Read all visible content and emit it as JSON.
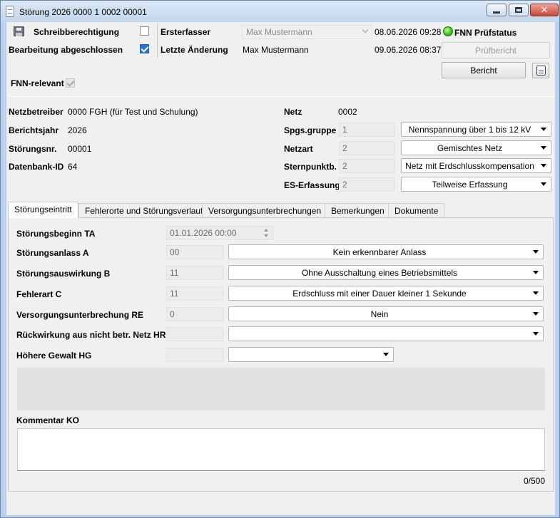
{
  "window": {
    "title": "Störung 2026 0000 1 0002 00001",
    "close_glyph": "✕"
  },
  "header": {
    "write_permission_label": "Schreibberechtigung",
    "write_permission_checked": false,
    "edit_completed_label": "Bearbeitung abgeschlossen",
    "edit_completed_checked": true,
    "fnn_relevant_label": "FNN-relevant",
    "fnn_relevant_checked": true,
    "creator_label": "Ersterfasser",
    "creator_value": "Max Mustermann",
    "created_date": "08.06.2026 09:28",
    "last_change_label": "Letzte Änderung",
    "last_change_value": "Max Mustermann",
    "last_change_date": "09.06.2026 08:37",
    "fnn_status_label": "FNN Prüfstatus",
    "fnn_status_color": "#39c41a",
    "check_report_button": "Prüfbericht",
    "report_button": "Bericht",
    "print_icon": "print-icon"
  },
  "info": {
    "operator_label": "Netzbetreiber",
    "operator_value": "0000 FGH (für Test und Schulung)",
    "report_year_label": "Berichtsjahr",
    "report_year_value": "2026",
    "fault_no_label": "Störungsnr.",
    "fault_no_value": "00001",
    "db_id_label": "Datenbank-ID",
    "db_id_value": "64",
    "grid_label": "Netz",
    "grid_value": "0002",
    "voltage_group_label": "Spgs.gruppe",
    "voltage_group_code": "1",
    "voltage_group_option": "Nennspannung über 1 bis 12 kV",
    "grid_type_label": "Netzart",
    "grid_type_code": "2",
    "grid_type_option": "Gemischtes Netz",
    "neutral_label": "Sternpunktb.",
    "neutral_code": "2",
    "neutral_option": "Netz mit Erdschlusskompensation",
    "es_label": "ES-Erfassung",
    "es_code": "2",
    "es_option": "Teilweise Erfassung"
  },
  "tabs": [
    {
      "label": "Störungseintritt",
      "active": true
    },
    {
      "label": "Fehlerorte und Störungsverlauf",
      "active": false
    },
    {
      "label": "Versorgungsunterbrechungen",
      "active": false
    },
    {
      "label": "Bemerkungen",
      "active": false
    },
    {
      "label": "Dokumente",
      "active": false
    }
  ],
  "form": {
    "start_label": "Störungsbeginn TA",
    "start_value": "01.01.2026 00:00",
    "cause_label": "Störungsanlass A",
    "cause_code": "00",
    "cause_option": "Kein erkennbarer Anlass",
    "effect_label": "Störungsauswirkung B",
    "effect_code": "11",
    "effect_option": "Ohne Ausschaltung eines Betriebsmittels",
    "fault_type_label": "Fehlerart C",
    "fault_type_code": "11",
    "fault_type_option": "Erdschluss mit einer Dauer kleiner 1 Sekunde",
    "supply_int_label": "Versorgungsunterbrechung RE",
    "supply_int_code": "0",
    "supply_int_option": "Nein",
    "feedback_label": "Rückwirkung aus nicht betr. Netz HR",
    "feedback_code": "",
    "feedback_option": "",
    "force_label": "Höhere Gewalt HG",
    "force_code": "",
    "force_option": "",
    "comment_label": "Kommentar KO",
    "comment_value": "",
    "comment_counter": "0/500"
  }
}
